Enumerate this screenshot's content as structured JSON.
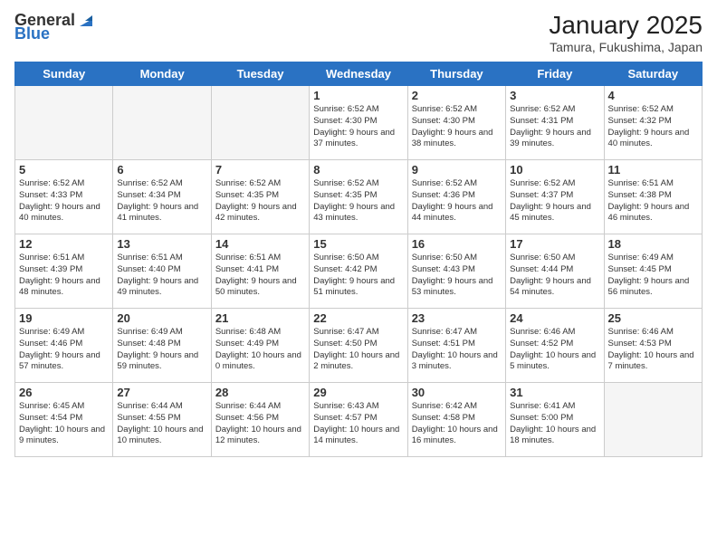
{
  "header": {
    "logo_general": "General",
    "logo_blue": "Blue",
    "month_year": "January 2025",
    "location": "Tamura, Fukushima, Japan"
  },
  "weekdays": [
    "Sunday",
    "Monday",
    "Tuesday",
    "Wednesday",
    "Thursday",
    "Friday",
    "Saturday"
  ],
  "weeks": [
    [
      {
        "day": "",
        "info": ""
      },
      {
        "day": "",
        "info": ""
      },
      {
        "day": "",
        "info": ""
      },
      {
        "day": "1",
        "info": "Sunrise: 6:52 AM\nSunset: 4:30 PM\nDaylight: 9 hours and 37 minutes."
      },
      {
        "day": "2",
        "info": "Sunrise: 6:52 AM\nSunset: 4:30 PM\nDaylight: 9 hours and 38 minutes."
      },
      {
        "day": "3",
        "info": "Sunrise: 6:52 AM\nSunset: 4:31 PM\nDaylight: 9 hours and 39 minutes."
      },
      {
        "day": "4",
        "info": "Sunrise: 6:52 AM\nSunset: 4:32 PM\nDaylight: 9 hours and 40 minutes."
      }
    ],
    [
      {
        "day": "5",
        "info": "Sunrise: 6:52 AM\nSunset: 4:33 PM\nDaylight: 9 hours and 40 minutes."
      },
      {
        "day": "6",
        "info": "Sunrise: 6:52 AM\nSunset: 4:34 PM\nDaylight: 9 hours and 41 minutes."
      },
      {
        "day": "7",
        "info": "Sunrise: 6:52 AM\nSunset: 4:35 PM\nDaylight: 9 hours and 42 minutes."
      },
      {
        "day": "8",
        "info": "Sunrise: 6:52 AM\nSunset: 4:35 PM\nDaylight: 9 hours and 43 minutes."
      },
      {
        "day": "9",
        "info": "Sunrise: 6:52 AM\nSunset: 4:36 PM\nDaylight: 9 hours and 44 minutes."
      },
      {
        "day": "10",
        "info": "Sunrise: 6:52 AM\nSunset: 4:37 PM\nDaylight: 9 hours and 45 minutes."
      },
      {
        "day": "11",
        "info": "Sunrise: 6:51 AM\nSunset: 4:38 PM\nDaylight: 9 hours and 46 minutes."
      }
    ],
    [
      {
        "day": "12",
        "info": "Sunrise: 6:51 AM\nSunset: 4:39 PM\nDaylight: 9 hours and 48 minutes."
      },
      {
        "day": "13",
        "info": "Sunrise: 6:51 AM\nSunset: 4:40 PM\nDaylight: 9 hours and 49 minutes."
      },
      {
        "day": "14",
        "info": "Sunrise: 6:51 AM\nSunset: 4:41 PM\nDaylight: 9 hours and 50 minutes."
      },
      {
        "day": "15",
        "info": "Sunrise: 6:50 AM\nSunset: 4:42 PM\nDaylight: 9 hours and 51 minutes."
      },
      {
        "day": "16",
        "info": "Sunrise: 6:50 AM\nSunset: 4:43 PM\nDaylight: 9 hours and 53 minutes."
      },
      {
        "day": "17",
        "info": "Sunrise: 6:50 AM\nSunset: 4:44 PM\nDaylight: 9 hours and 54 minutes."
      },
      {
        "day": "18",
        "info": "Sunrise: 6:49 AM\nSunset: 4:45 PM\nDaylight: 9 hours and 56 minutes."
      }
    ],
    [
      {
        "day": "19",
        "info": "Sunrise: 6:49 AM\nSunset: 4:46 PM\nDaylight: 9 hours and 57 minutes."
      },
      {
        "day": "20",
        "info": "Sunrise: 6:49 AM\nSunset: 4:48 PM\nDaylight: 9 hours and 59 minutes."
      },
      {
        "day": "21",
        "info": "Sunrise: 6:48 AM\nSunset: 4:49 PM\nDaylight: 10 hours and 0 minutes."
      },
      {
        "day": "22",
        "info": "Sunrise: 6:47 AM\nSunset: 4:50 PM\nDaylight: 10 hours and 2 minutes."
      },
      {
        "day": "23",
        "info": "Sunrise: 6:47 AM\nSunset: 4:51 PM\nDaylight: 10 hours and 3 minutes."
      },
      {
        "day": "24",
        "info": "Sunrise: 6:46 AM\nSunset: 4:52 PM\nDaylight: 10 hours and 5 minutes."
      },
      {
        "day": "25",
        "info": "Sunrise: 6:46 AM\nSunset: 4:53 PM\nDaylight: 10 hours and 7 minutes."
      }
    ],
    [
      {
        "day": "26",
        "info": "Sunrise: 6:45 AM\nSunset: 4:54 PM\nDaylight: 10 hours and 9 minutes."
      },
      {
        "day": "27",
        "info": "Sunrise: 6:44 AM\nSunset: 4:55 PM\nDaylight: 10 hours and 10 minutes."
      },
      {
        "day": "28",
        "info": "Sunrise: 6:44 AM\nSunset: 4:56 PM\nDaylight: 10 hours and 12 minutes."
      },
      {
        "day": "29",
        "info": "Sunrise: 6:43 AM\nSunset: 4:57 PM\nDaylight: 10 hours and 14 minutes."
      },
      {
        "day": "30",
        "info": "Sunrise: 6:42 AM\nSunset: 4:58 PM\nDaylight: 10 hours and 16 minutes."
      },
      {
        "day": "31",
        "info": "Sunrise: 6:41 AM\nSunset: 5:00 PM\nDaylight: 10 hours and 18 minutes."
      },
      {
        "day": "",
        "info": ""
      }
    ]
  ]
}
